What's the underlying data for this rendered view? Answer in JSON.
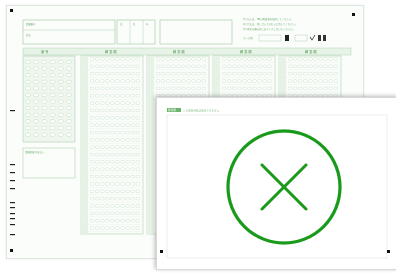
{
  "back_sheet": {
    "header_label": "受験番号",
    "name_label": "氏名",
    "small_labels": [
      "氏",
      "名",
      "年"
    ],
    "section_headers": [
      "番 号",
      "解 答 欄",
      "解 答 欄",
      "解 答 欄",
      "解 答 欄"
    ],
    "notes": [
      "(1) 記入は、HBの黒鉛筆を使用してください。",
      "(2) 訂正は、消しゴムできれいに消してください。",
      "(3) 所定の欄以外にはマークしないでください。"
    ],
    "marking_example_label": "マーク例",
    "side_box_label": "受験者番号を記入"
  },
  "front_sheet": {
    "header_tag": "解答欄",
    "header_text": "この解答用紙は使用できません",
    "status_icon": "x-circle-icon",
    "colors": {
      "accent": "#1a9a1a",
      "form_green": "#9cc79c"
    }
  }
}
